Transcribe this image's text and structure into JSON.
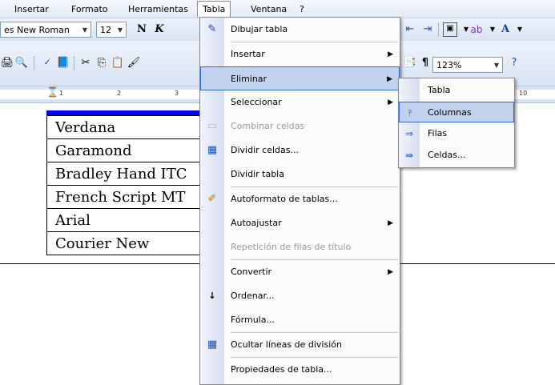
{
  "menubar": {
    "items": [
      "Insertar",
      "Formato",
      "Herramientas",
      "Tabla",
      "Ventana",
      "?"
    ]
  },
  "format_toolbar": {
    "font_name": "es New Roman",
    "font_size": "12",
    "bold": "N",
    "italic": "K",
    "zoom": "123%"
  },
  "ruler": {
    "numbers": [
      "1",
      "2",
      "3",
      "10"
    ]
  },
  "document_table": {
    "rows": [
      "Verdana",
      "Garamond",
      "Bradley Hand ITC",
      "French Script MT",
      "Arial",
      "Courier New"
    ]
  },
  "tabla_menu": {
    "items": [
      {
        "label": "Dibujar tabla",
        "icon": "pencil-icon",
        "disabled": false
      },
      {
        "label": "Insertar",
        "submenu": true
      },
      {
        "label": "Eliminar",
        "submenu": true,
        "highlighted": true
      },
      {
        "label": "Seleccionar",
        "submenu": true
      },
      {
        "label": "Combinar celdas",
        "icon": "merge-cells-icon",
        "disabled": true
      },
      {
        "label": "Dividir celdas...",
        "icon": "split-cells-icon",
        "disabled": false
      },
      {
        "label": "Dividir tabla"
      },
      {
        "label": "Autoformato de tablas...",
        "icon": "autoformat-icon"
      },
      {
        "label": "Autoajustar",
        "submenu": true
      },
      {
        "label": "Repetición de filas de título",
        "disabled": true
      },
      {
        "label": "Convertir",
        "submenu": true
      },
      {
        "label": "Ordenar...",
        "icon": "sort-az-icon"
      },
      {
        "label": "Fórmula..."
      },
      {
        "label": "Ocultar líneas de división",
        "icon": "gridlines-icon"
      },
      {
        "label": "Propiedades de tabla..."
      }
    ]
  },
  "eliminar_submenu": {
    "items": [
      {
        "label": "Tabla"
      },
      {
        "label": "Columnas",
        "icon": "delete-columns-icon",
        "highlighted": true
      },
      {
        "label": "Filas",
        "icon": "delete-rows-icon"
      },
      {
        "label": "Celdas...",
        "icon": "delete-cells-icon"
      }
    ]
  },
  "colors": {
    "highlight": "#c1d2ee",
    "highlight_border": "#316ac5",
    "table_top_bar": "#0000ff"
  }
}
